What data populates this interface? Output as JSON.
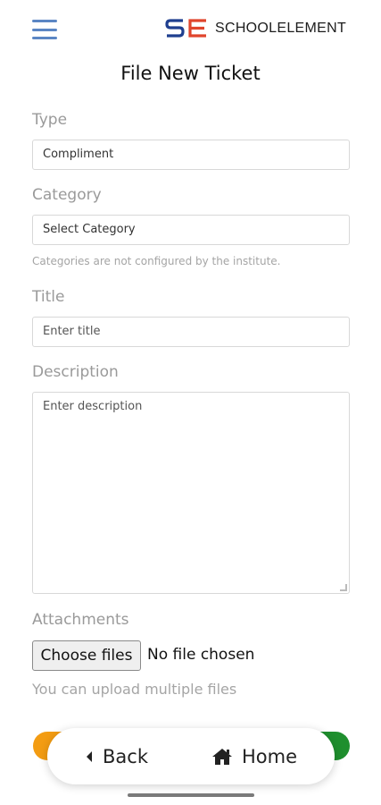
{
  "header": {
    "brand_mark": "SE",
    "brand_name": "SCHOOLELEMENT",
    "brand_colors": {
      "s": "#1f3f8f",
      "e": "#e0452c"
    },
    "menu_icon": "hamburger-menu-icon"
  },
  "page": {
    "title": "File New Ticket"
  },
  "form": {
    "type": {
      "label": "Type",
      "value": "Compliment"
    },
    "category": {
      "label": "Category",
      "value": "Select Category",
      "hint": "Categories are not configured by the institute."
    },
    "title": {
      "label": "Title",
      "placeholder": "Enter title"
    },
    "description": {
      "label": "Description",
      "placeholder": "Enter description"
    },
    "attachments": {
      "label": "Attachments",
      "button_label": "Choose files",
      "status": "No file chosen",
      "hint": "You can upload multiple files"
    }
  },
  "bottom_nav": {
    "back_label": "Back",
    "back_icon": "caret-left-icon",
    "home_label": "Home",
    "home_icon": "home-icon",
    "left_accent": "#f39c12",
    "right_accent": "#1f8f2e"
  }
}
